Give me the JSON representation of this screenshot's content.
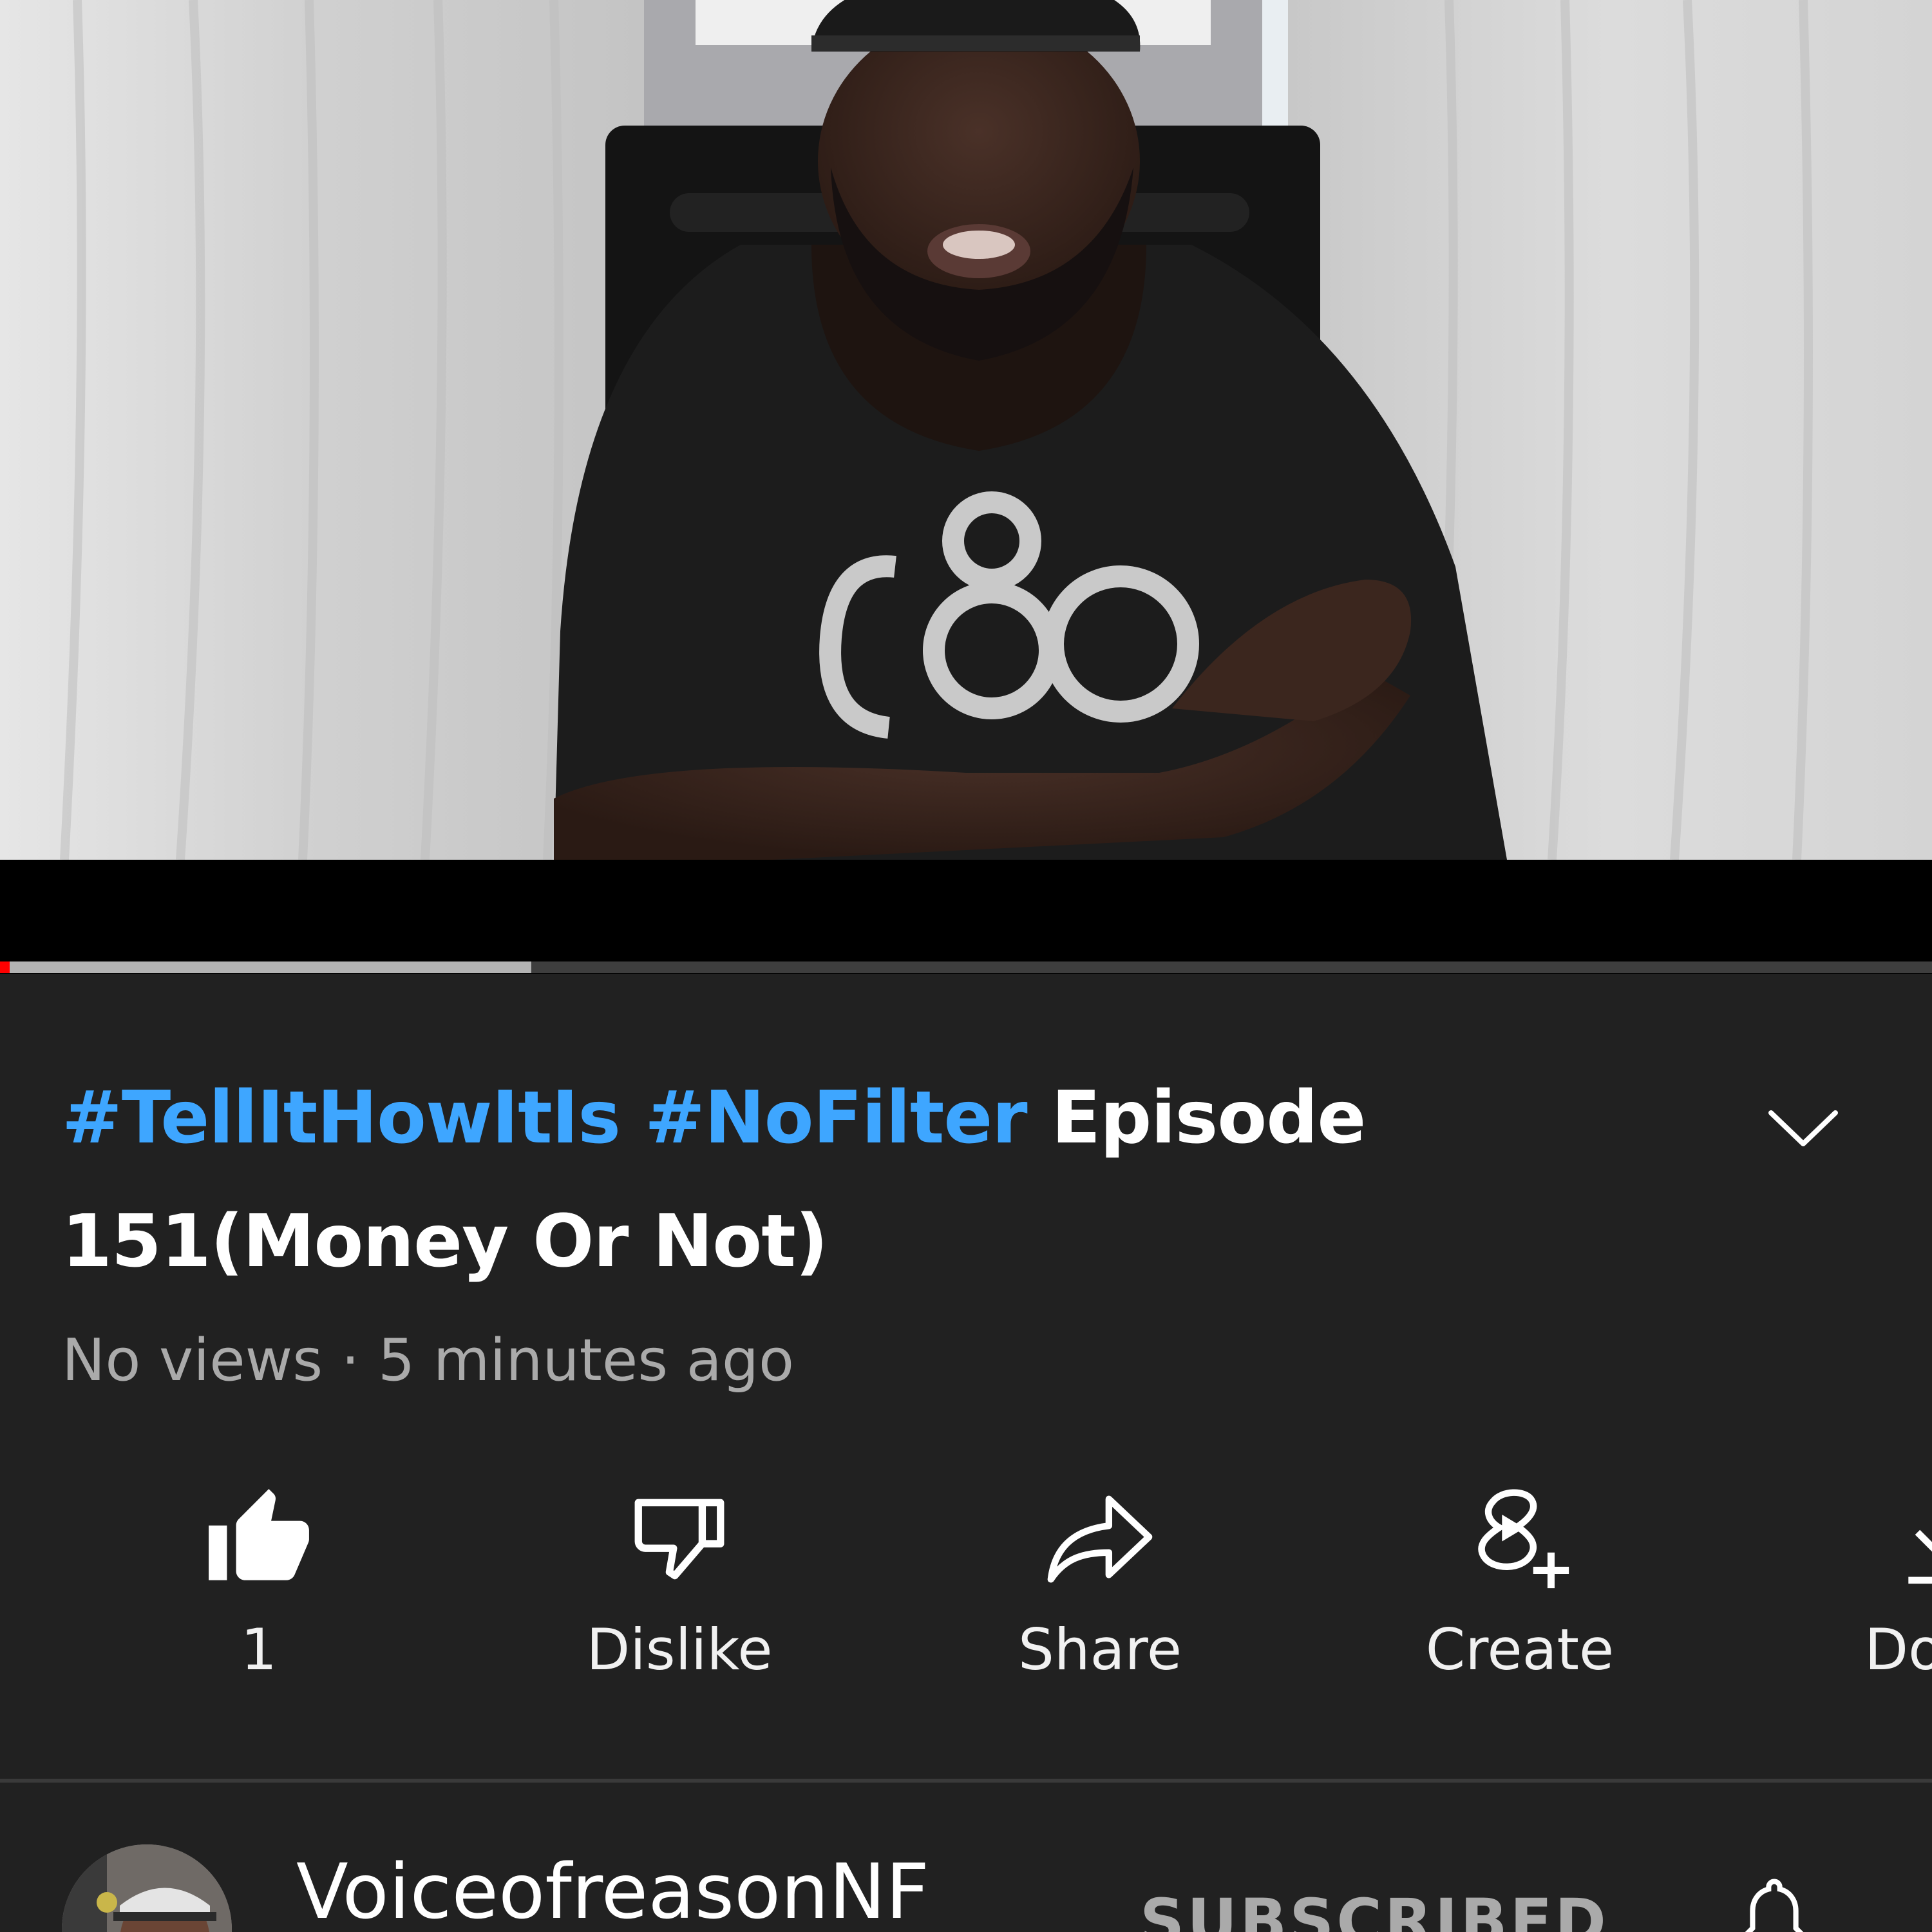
{
  "player": {
    "progress": {
      "played_fraction": 0.003,
      "buffered_fraction": 0.275
    },
    "colors": {
      "played": "#ff0000",
      "buffered": "#b3b3b3",
      "track": "#3e3e3e"
    }
  },
  "video": {
    "title_tags": [
      "#TellItHowItIs",
      "#NoFilter"
    ],
    "title_text": "Episode 151(Money Or Not)",
    "views": "No views",
    "separator": "·",
    "age": "5 minutes ago",
    "hashtag_color": "#3ea6ff"
  },
  "expand_icon": "chevron-down-icon",
  "actions": [
    {
      "id": "like",
      "icon": "thumbs-up-icon",
      "label": "1"
    },
    {
      "id": "dislike",
      "icon": "thumbs-down-icon",
      "label": "Dislike"
    },
    {
      "id": "share",
      "icon": "share-icon",
      "label": "Share"
    },
    {
      "id": "create",
      "icon": "create-icon",
      "label": "Create"
    },
    {
      "id": "download",
      "icon": "download-icon",
      "label": "Down"
    }
  ],
  "channel": {
    "name": "VoiceofreasonNF",
    "subscribe_label": "SUBSCRIBED",
    "bell_icon": "bell-icon"
  }
}
